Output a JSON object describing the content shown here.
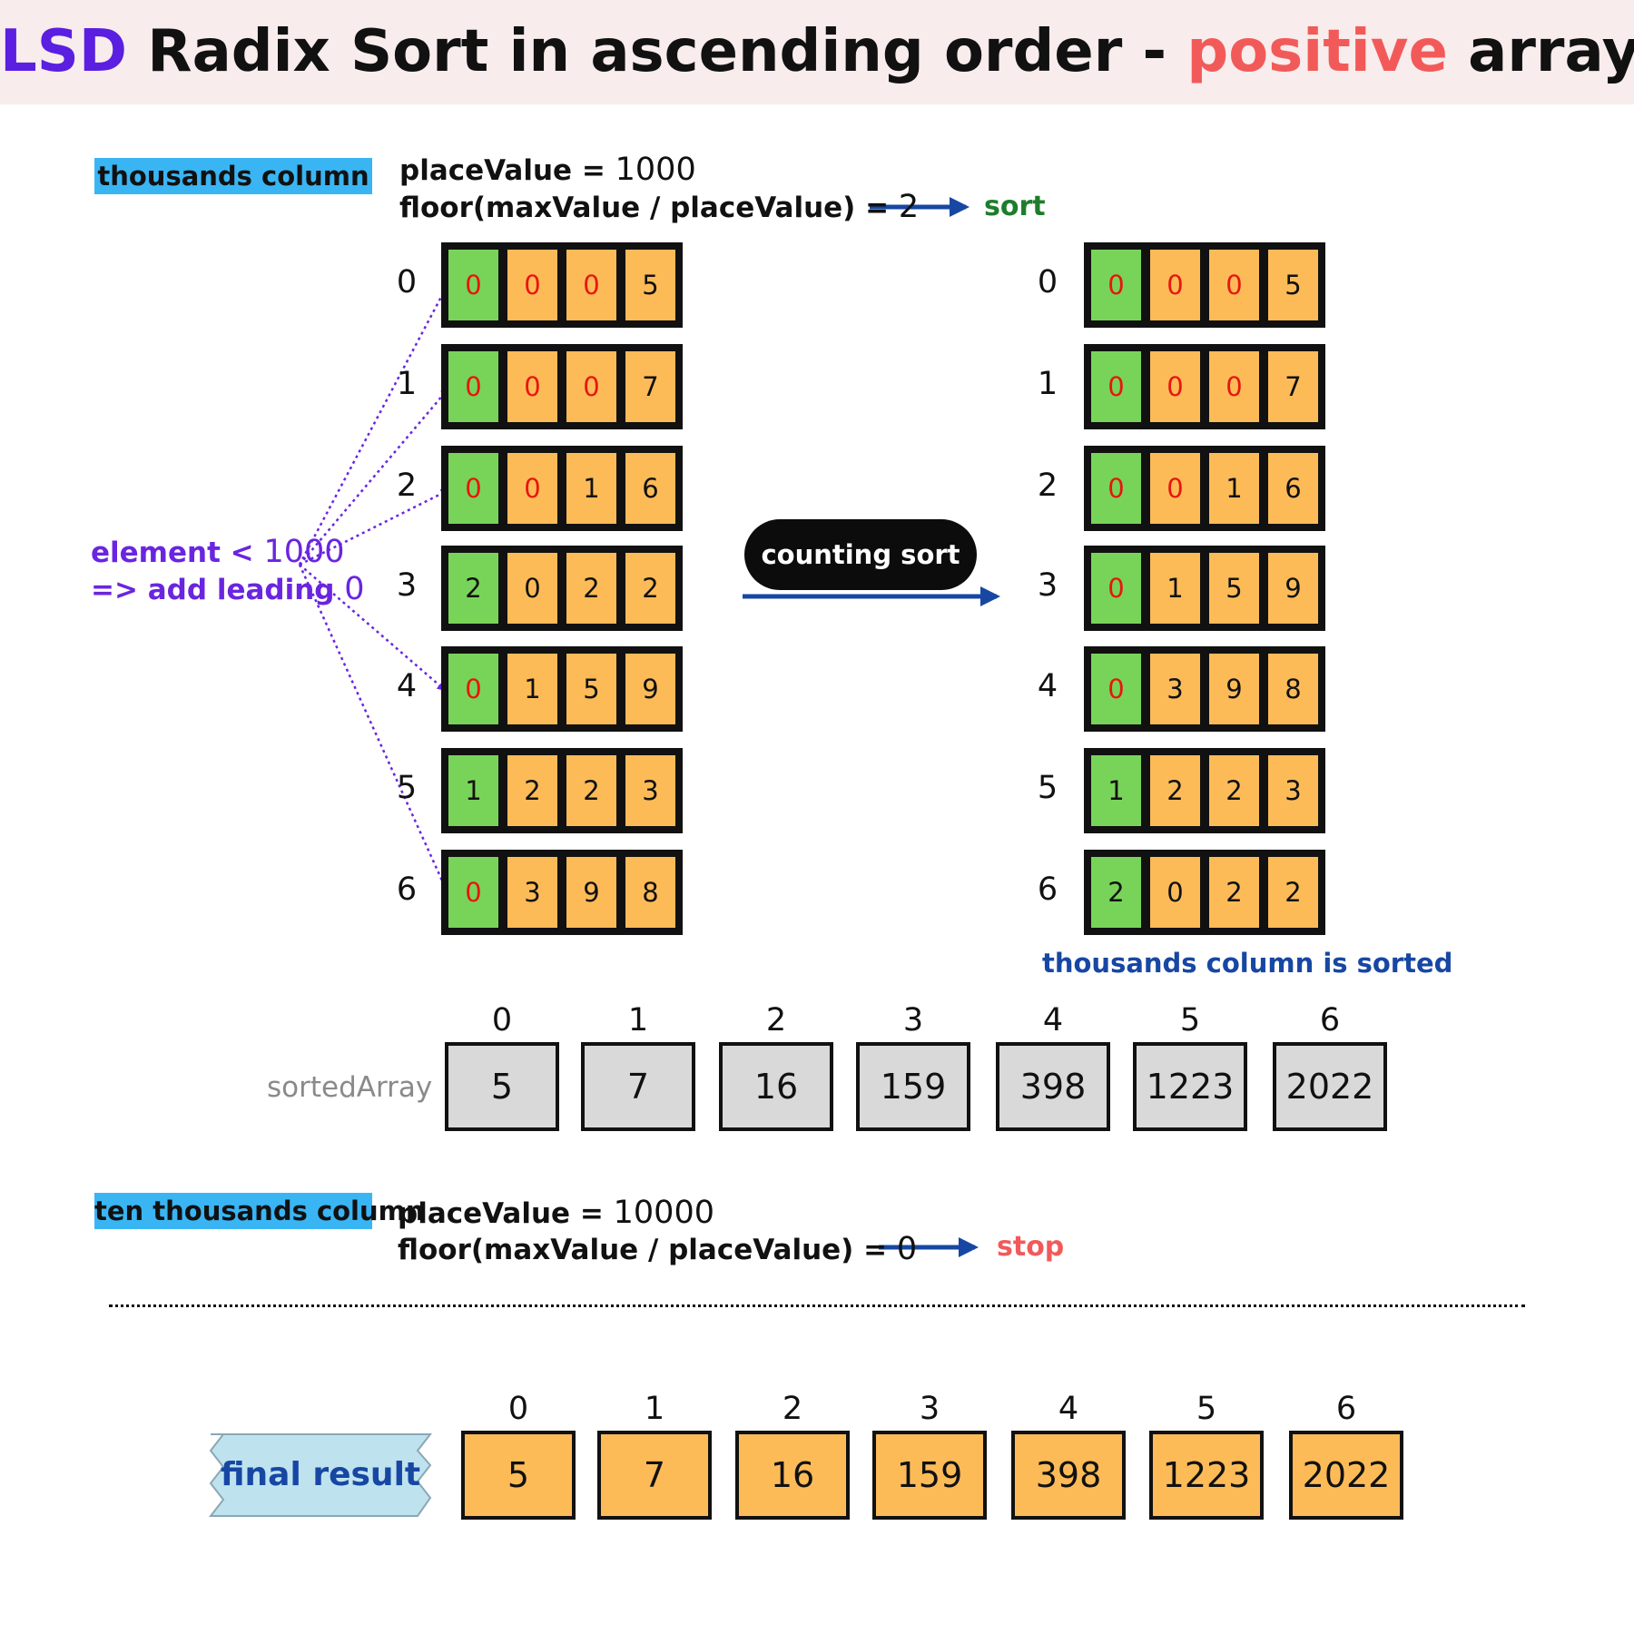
{
  "title": {
    "part_lsd": "LSD",
    "part_middle": " Radix Sort in ascending order - ",
    "part_positive": "positive",
    "part_end": " array"
  },
  "thousands": {
    "tag": "thousands column",
    "line1_label": "placeValue = ",
    "line1_value": "1000",
    "line2_label": "floor(maxValue / placeValue) = ",
    "line2_value": "2",
    "action": "sort"
  },
  "annotation": {
    "line1_label": "element < ",
    "line1_value": "1000",
    "line2_label": "=> add leading ",
    "line2_value": "0"
  },
  "counting_sort_label": "counting sort",
  "sorted_note": "thousands column is sorted",
  "before_rows": [
    {
      "index": "0",
      "digits": [
        "0",
        "0",
        "0",
        "5"
      ],
      "padded": 3
    },
    {
      "index": "1",
      "digits": [
        "0",
        "0",
        "0",
        "7"
      ],
      "padded": 3
    },
    {
      "index": "2",
      "digits": [
        "0",
        "0",
        "1",
        "6"
      ],
      "padded": 2
    },
    {
      "index": "3",
      "digits": [
        "2",
        "0",
        "2",
        "2"
      ],
      "padded": 0
    },
    {
      "index": "4",
      "digits": [
        "0",
        "1",
        "5",
        "9"
      ],
      "padded": 1
    },
    {
      "index": "5",
      "digits": [
        "1",
        "2",
        "2",
        "3"
      ],
      "padded": 0
    },
    {
      "index": "6",
      "digits": [
        "0",
        "3",
        "9",
        "8"
      ],
      "padded": 1
    }
  ],
  "after_rows": [
    {
      "index": "0",
      "digits": [
        "0",
        "0",
        "0",
        "5"
      ],
      "padded": 3
    },
    {
      "index": "1",
      "digits": [
        "0",
        "0",
        "0",
        "7"
      ],
      "padded": 3
    },
    {
      "index": "2",
      "digits": [
        "0",
        "0",
        "1",
        "6"
      ],
      "padded": 2
    },
    {
      "index": "3",
      "digits": [
        "0",
        "1",
        "5",
        "9"
      ],
      "padded": 1
    },
    {
      "index": "4",
      "digits": [
        "0",
        "3",
        "9",
        "8"
      ],
      "padded": 1
    },
    {
      "index": "5",
      "digits": [
        "1",
        "2",
        "2",
        "3"
      ],
      "padded": 0
    },
    {
      "index": "6",
      "digits": [
        "2",
        "0",
        "2",
        "2"
      ],
      "padded": 0
    }
  ],
  "sorted_array": {
    "label": "sortedArray",
    "indices": [
      "0",
      "1",
      "2",
      "3",
      "4",
      "5",
      "6"
    ],
    "values": [
      "5",
      "7",
      "16",
      "159",
      "398",
      "1223",
      "2022"
    ]
  },
  "ten_thousands": {
    "tag": "ten thousands column",
    "line1_label": "placeValue = ",
    "line1_value": "10000",
    "line2_label": "floor(maxValue / placeValue) = ",
    "line2_value": "0",
    "action": "stop"
  },
  "final_result": {
    "label": "final result",
    "indices": [
      "0",
      "1",
      "2",
      "3",
      "4",
      "5",
      "6"
    ],
    "values": [
      "5",
      "7",
      "16",
      "159",
      "398",
      "1223",
      "2022"
    ]
  },
  "colors": {
    "banner": "#f8ecec",
    "lsd": "#5a1fe0",
    "positive": "#f25a5a",
    "tag": "#39b5f4",
    "cell_orange": "#fdbb58",
    "cell_green": "#78d458",
    "pad_digit": "#e8160e",
    "arrow_blue": "#1747a3",
    "annotation_purple": "#6a25e0",
    "final_tag": "#bfe3ee"
  }
}
